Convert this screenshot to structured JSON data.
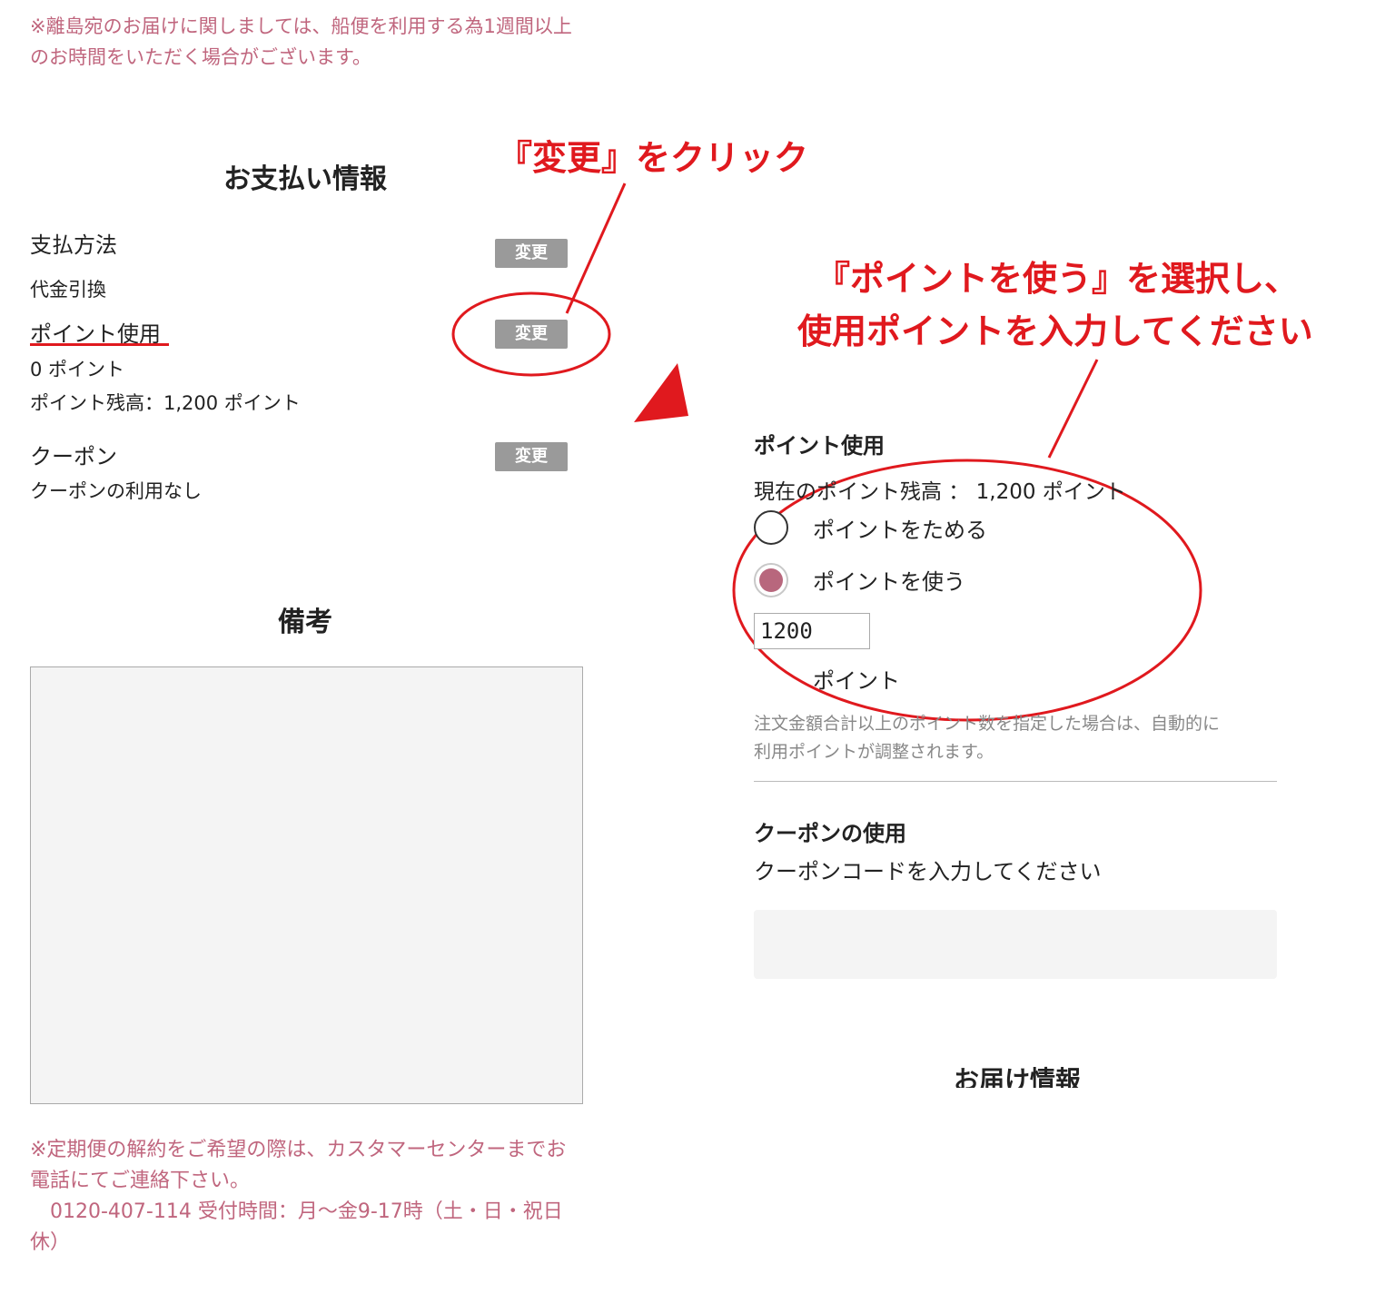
{
  "top_note": {
    "line1": "※離島宛のお届けに関しましては、船便を利用する為1週間以上",
    "line2": "のお時間をいただく場合がございます。"
  },
  "payment": {
    "title": "お支払い情報",
    "method_label": "支払方法",
    "method_value": "代金引換",
    "points_label": "ポイント使用",
    "points_value": "0 ポイント",
    "points_balance": "ポイント残高：1,200 ポイント",
    "coupon_label": "クーポン",
    "coupon_value": "クーポンの利用なし",
    "change_label": "変更"
  },
  "remarks": {
    "title": "備考",
    "textarea_value": ""
  },
  "bottom_note": {
    "line1": "※定期便の解約をご希望の際は、カスタマーセンターまでお",
    "line2": "電話にてご連絡下さい。",
    "line3": "0120-407-114 受付時間：月〜金9-17時（土・日・祝日",
    "line4": "休）"
  },
  "annotations": {
    "click_change": "『変更』をクリック",
    "select_use_line1": "『ポイントを使う』を選択し、",
    "select_use_line2": "使用ポイントを入力してください",
    "color": "#e0191e"
  },
  "points_panel": {
    "title": "ポイント使用",
    "balance": "現在のポイント残高 ： 1,200 ポイント",
    "option_save": "ポイントをためる",
    "option_use": "ポイントを使う",
    "selected": "option_use",
    "input_value": "1200",
    "unit": "ポイント",
    "note_line1": "注文金額合計以上のポイント数を指定した場合は、自動的に",
    "note_line2": "利用ポイントが調整されます。",
    "accent_color": "#b8677d"
  },
  "coupon_panel": {
    "title": "クーポンの使用",
    "instruction": "クーポンコードを入力してください",
    "input_value": ""
  },
  "delivery": {
    "title": "お届け情報"
  }
}
